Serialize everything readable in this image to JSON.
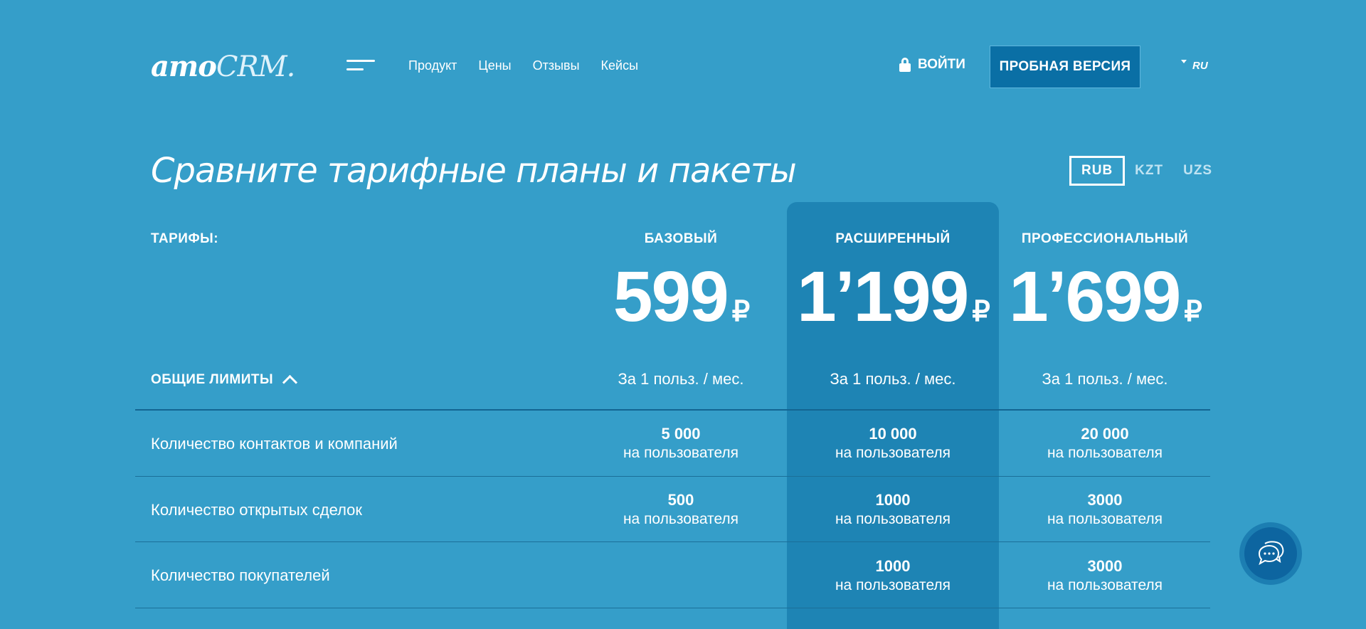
{
  "header": {
    "logo_main": "amo",
    "logo_accent": "CRM.",
    "nav": [
      "Продукт",
      "Цены",
      "Отзывы",
      "Кейсы"
    ],
    "login_label": "ВОЙТИ",
    "trial_label": "ПРОБНАЯ ВЕРСИЯ",
    "language": "RU"
  },
  "page": {
    "title": "Сравните тарифные планы и пакеты",
    "currencies": [
      "RUB",
      "KZT",
      "UZS"
    ],
    "active_currency": "RUB"
  },
  "pricing": {
    "tariffs_label": "ТАРИФЫ:",
    "limits_label": "ОБЩИЕ ЛИМИТЫ",
    "currency_symbol": "₽",
    "plans": [
      {
        "name": "БАЗОВЫЙ",
        "price": "599",
        "per": "За 1 польз. / мес."
      },
      {
        "name": "РАСШИРЕННЫЙ",
        "price": "1’199",
        "per": "За 1 польз. / мес."
      },
      {
        "name": "ПРОФЕССИОНАЛЬНЫЙ",
        "price": "1’699",
        "per": "За 1 польз. / мес."
      }
    ],
    "rows": [
      {
        "label": "Количество контактов и компаний",
        "values": [
          "5 000",
          "10 000",
          "20 000"
        ],
        "unit": "на пользователя"
      },
      {
        "label": "Количество открытых сделок",
        "values": [
          "500",
          "1000",
          "3000"
        ],
        "unit": "на пользователя"
      },
      {
        "label": "Количество покупателей",
        "values": [
          "",
          "1000",
          "3000"
        ],
        "unit": "на пользователя"
      }
    ]
  },
  "colors": {
    "background": "#359ec9",
    "highlight_column": "#1e84b4",
    "trial_button": "#0a6fa5"
  },
  "icons": [
    "menu-icon",
    "lock-icon",
    "caret-down-icon",
    "chevron-up-icon",
    "chat-icon"
  ]
}
